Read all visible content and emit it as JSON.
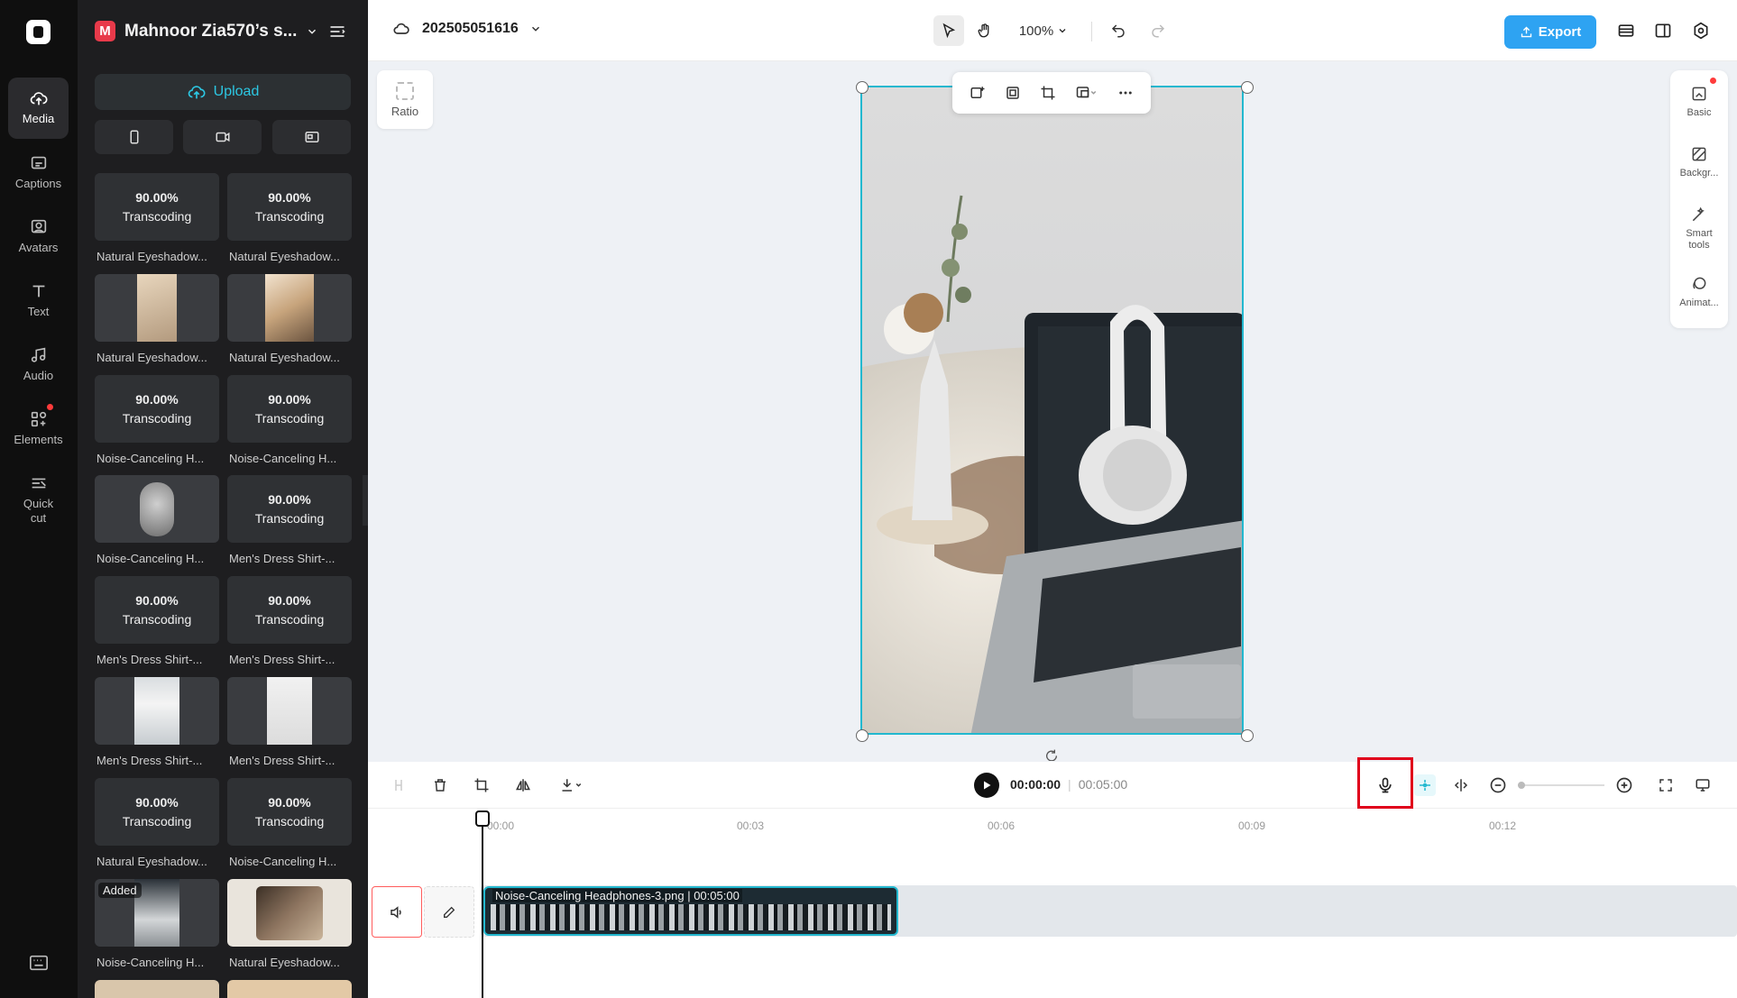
{
  "workspace": {
    "initial": "M",
    "name": "Mahnoor Zia570’s s..."
  },
  "project": {
    "name": "202505051616"
  },
  "toolbar": {
    "zoom": "100%",
    "export_label": "Export"
  },
  "rail": [
    {
      "label": "Media",
      "icon": "media-icon",
      "active": true
    },
    {
      "label": "Captions",
      "icon": "captions-icon"
    },
    {
      "label": "Avatars",
      "icon": "avatars-icon"
    },
    {
      "label": "Text",
      "icon": "text-icon"
    },
    {
      "label": "Audio",
      "icon": "audio-icon"
    },
    {
      "label": "Elements",
      "icon": "elements-icon"
    },
    {
      "label": "Quick cut",
      "icon": "quick-cut-icon"
    }
  ],
  "media": {
    "upload_label": "Upload",
    "items": [
      {
        "pct": "90.00%",
        "status": "Transcoding",
        "name": "Natural Eyeshadow..."
      },
      {
        "pct": "90.00%",
        "status": "Transcoding",
        "name": "Natural Eyeshadow..."
      },
      {
        "pct": "",
        "status": "",
        "name": "Natural Eyeshadow..."
      },
      {
        "pct": "",
        "status": "",
        "name": "Natural Eyeshadow..."
      },
      {
        "pct": "90.00%",
        "status": "Transcoding",
        "name": "Noise-Canceling H..."
      },
      {
        "pct": "90.00%",
        "status": "Transcoding",
        "name": "Noise-Canceling H..."
      },
      {
        "pct": "",
        "status": "",
        "name": "Noise-Canceling H..."
      },
      {
        "pct": "90.00%",
        "status": "Transcoding",
        "name": "Men's Dress Shirt-..."
      },
      {
        "pct": "90.00%",
        "status": "Transcoding",
        "name": "Men's Dress Shirt-..."
      },
      {
        "pct": "90.00%",
        "status": "Transcoding",
        "name": "Men's Dress Shirt-..."
      },
      {
        "pct": "",
        "status": "",
        "name": "Men's Dress Shirt-..."
      },
      {
        "pct": "",
        "status": "",
        "name": "Men's Dress Shirt-..."
      },
      {
        "pct": "90.00%",
        "status": "Transcoding",
        "name": "Natural Eyeshadow..."
      },
      {
        "pct": "90.00%",
        "status": "Transcoding",
        "name": "Noise-Canceling H..."
      },
      {
        "pct": "",
        "status": "",
        "name": "Noise-Canceling H...",
        "badge": "Added"
      },
      {
        "pct": "",
        "status": "",
        "name": "Natural Eyeshadow..."
      }
    ]
  },
  "canvas": {
    "ratio_label": "Ratio"
  },
  "right_panel": [
    {
      "label": "Basic",
      "icon": "basic-icon"
    },
    {
      "label": "Backgr...",
      "icon": "background-icon"
    },
    {
      "label": "Smart tools",
      "icon": "smart-tools-icon"
    },
    {
      "label": "Animat...",
      "icon": "animation-icon"
    }
  ],
  "playback": {
    "current": "00:00:00",
    "total": "00:05:00"
  },
  "ruler": [
    "00:00",
    "00:03",
    "00:06",
    "00:09",
    "00:12"
  ],
  "clip": {
    "label": "Noise-Canceling Headphones-3.png",
    "duration": "00:05:00"
  },
  "colors": {
    "accent": "#22b8cf",
    "export": "#2ea3f2",
    "highlight": "#e0001b"
  }
}
